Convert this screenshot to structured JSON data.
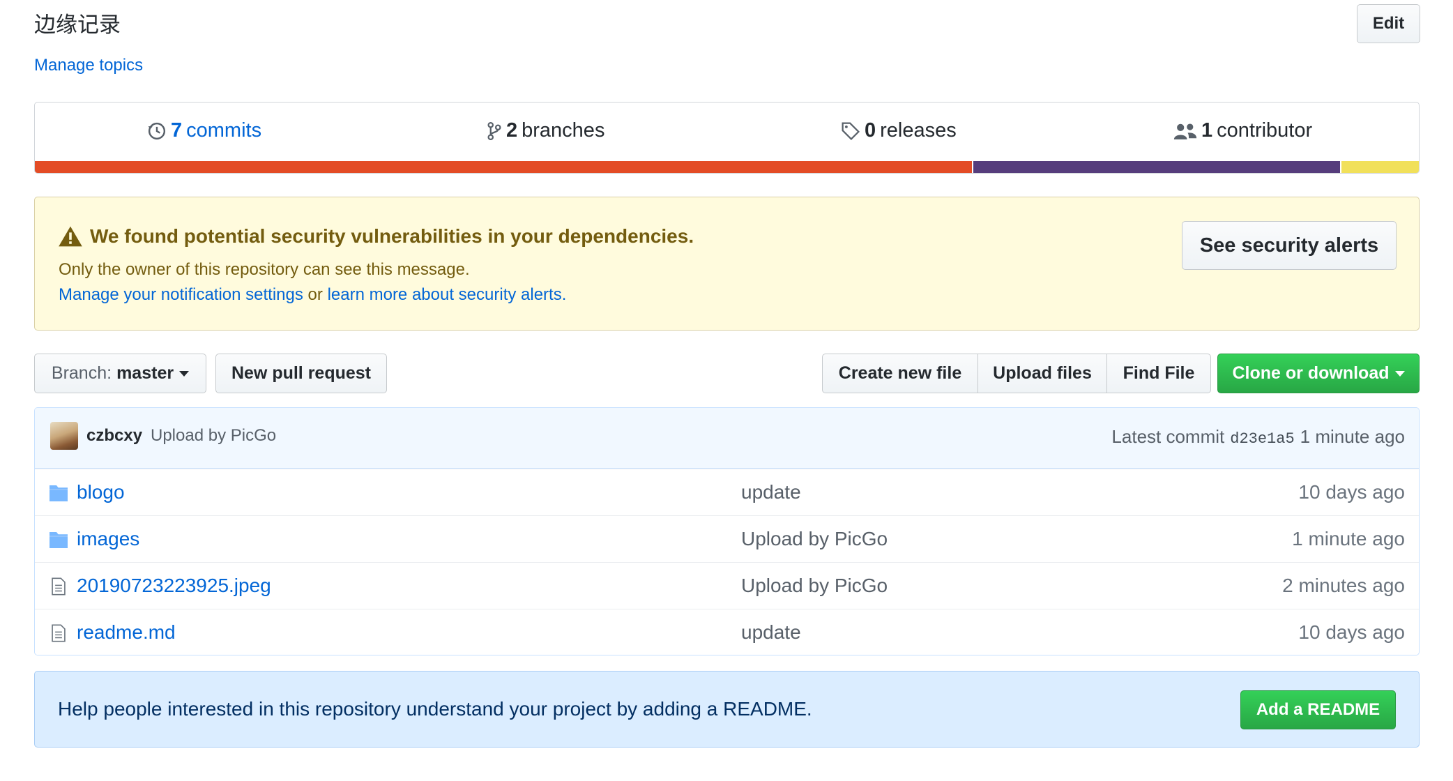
{
  "repo": {
    "description": "边缘记录",
    "edit_label": "Edit",
    "manage_topics": "Manage topics"
  },
  "summary": {
    "commits_count": "7",
    "commits_label": "commits",
    "branches_count": "2",
    "branches_label": "branches",
    "releases_count": "0",
    "releases_label": "releases",
    "contributors_count": "1",
    "contributors_label": "contributor",
    "languages": [
      {
        "color": "#e34c26",
        "fraction": 0.677
      },
      {
        "color": "#563d7c",
        "fraction": 0.266
      },
      {
        "color": "#f1e05a",
        "fraction": 0.057
      }
    ]
  },
  "alert": {
    "title": "We found potential security vulnerabilities in your dependencies.",
    "subtitle": "Only the owner of this repository can see this message.",
    "link_notifications": "Manage your notification settings",
    "connector": "or",
    "link_learn": "learn more about security alerts",
    "period": ".",
    "button": "See security alerts"
  },
  "file_nav": {
    "branch_prefix": "Branch:",
    "branch_name": "master",
    "new_pull_request": "New pull request",
    "create_new_file": "Create new file",
    "upload_files": "Upload files",
    "find_file": "Find File",
    "clone_or_download": "Clone or download"
  },
  "latest_commit": {
    "author": "czbcxy",
    "message": "Upload by PicGo",
    "prefix": "Latest commit",
    "sha": "d23e1a5",
    "age": "1 minute ago"
  },
  "files": [
    {
      "type": "folder",
      "name": "blogo",
      "message": "update",
      "age": "10 days ago"
    },
    {
      "type": "folder",
      "name": "images",
      "message": "Upload by PicGo",
      "age": "1 minute ago"
    },
    {
      "type": "file",
      "name": "20190723223925.jpeg",
      "message": "Upload by PicGo",
      "age": "2 minutes ago"
    },
    {
      "type": "file",
      "name": "readme.md",
      "message": "update",
      "age": "10 days ago"
    }
  ],
  "readme_prompt": {
    "text": "Help people interested in this repository understand your project by adding a README.",
    "button": "Add a README"
  },
  "colors": {
    "link": "#0366d6",
    "success": "#28a745",
    "alert_bg": "#fffbdd",
    "info_bg": "#dbedff"
  }
}
